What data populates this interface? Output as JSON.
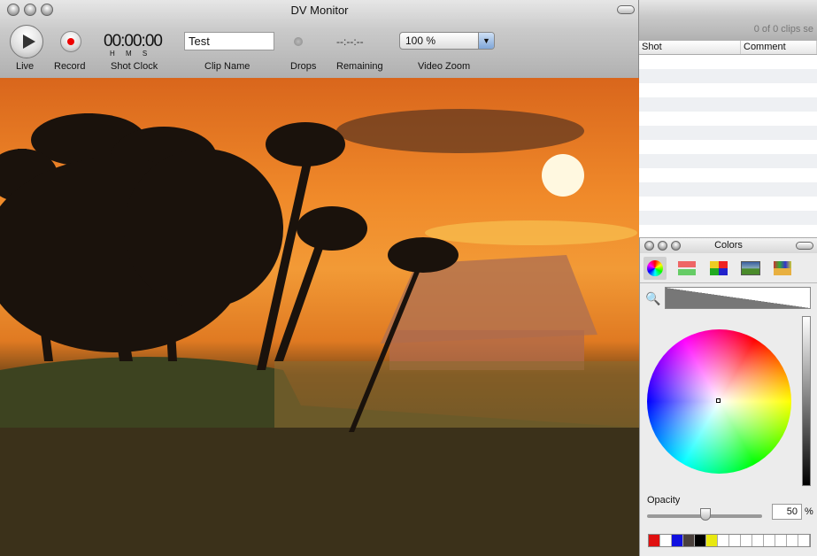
{
  "monitor": {
    "title": "DV Monitor",
    "shot_clock": "00:00:00",
    "hms": "H M S",
    "clip_name": "Test",
    "remaining": "--:--:--",
    "video_zoom": "100 %",
    "labels": {
      "live": "Live",
      "record": "Record",
      "shot_clock": "Shot Clock",
      "clip_name": "Clip Name",
      "drops": "Drops",
      "remaining": "Remaining",
      "video_zoom": "Video Zoom"
    }
  },
  "clips": {
    "status": "0 of 0 clips se",
    "columns": [
      "Shot",
      "Comment"
    ]
  },
  "colors": {
    "title": "Colors",
    "opacity_label": "Opacity",
    "opacity_value": "50",
    "percent": "%",
    "swatches": [
      "#e01010",
      "#ffffff",
      "#1010e0",
      "#4a403c",
      "#000000",
      "#e8e810",
      "#ffffff",
      "#ffffff",
      "#ffffff",
      "#ffffff",
      "#ffffff",
      "#ffffff",
      "#ffffff",
      "#ffffff"
    ]
  }
}
